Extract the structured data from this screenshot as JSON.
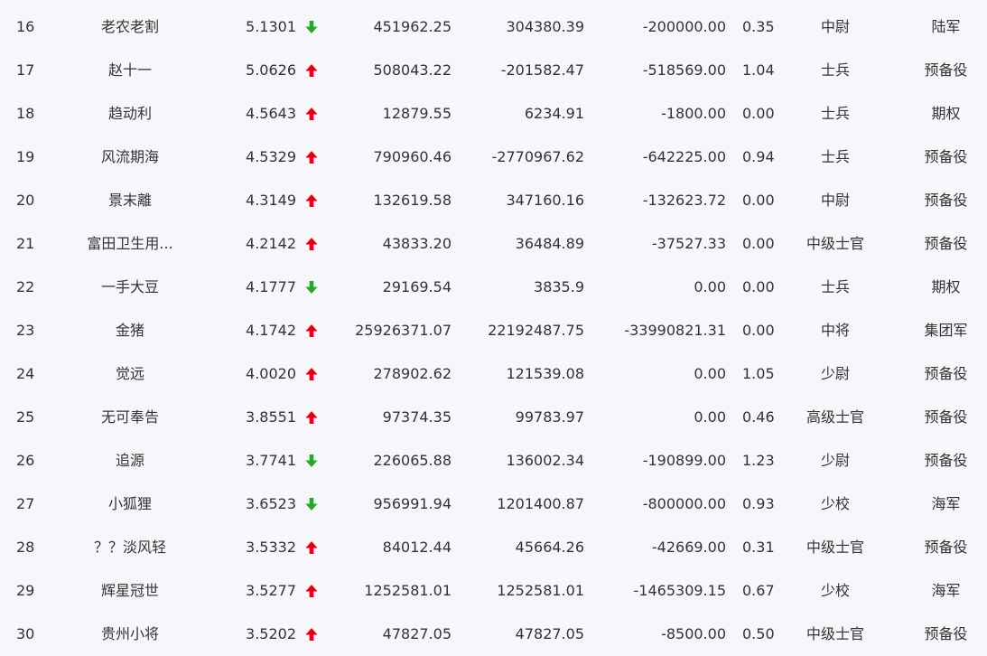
{
  "colors": {
    "up": "#e60012",
    "down": "#21ad2b",
    "text": "#333333",
    "background": "#f5f7fa"
  },
  "rows": [
    {
      "rank": "16",
      "name": "老农老割",
      "score": "5.1301",
      "trend": "down",
      "v1": "451962.25",
      "v2": "304380.39",
      "v3": "-200000.00",
      "ratio": "0.35",
      "military_rank": "中尉",
      "group": "陆军"
    },
    {
      "rank": "17",
      "name": "赵十一",
      "score": "5.0626",
      "trend": "up",
      "v1": "508043.22",
      "v2": "-201582.47",
      "v3": "-518569.00",
      "ratio": "1.04",
      "military_rank": "士兵",
      "group": "预备役"
    },
    {
      "rank": "18",
      "name": "趋动利",
      "score": "4.5643",
      "trend": "up",
      "v1": "12879.55",
      "v2": "6234.91",
      "v3": "-1800.00",
      "ratio": "0.00",
      "military_rank": "士兵",
      "group": "期权"
    },
    {
      "rank": "19",
      "name": "风流期海",
      "score": "4.5329",
      "trend": "up",
      "v1": "790960.46",
      "v2": "-2770967.62",
      "v3": "-642225.00",
      "ratio": "0.94",
      "military_rank": "士兵",
      "group": "预备役"
    },
    {
      "rank": "20",
      "name": "景末離",
      "score": "4.3149",
      "trend": "up",
      "v1": "132619.58",
      "v2": "347160.16",
      "v3": "-132623.72",
      "ratio": "0.00",
      "military_rank": "中尉",
      "group": "预备役"
    },
    {
      "rank": "21",
      "name": "富田卫生用...",
      "score": "4.2142",
      "trend": "up",
      "v1": "43833.20",
      "v2": "36484.89",
      "v3": "-37527.33",
      "ratio": "0.00",
      "military_rank": "中级士官",
      "group": "预备役"
    },
    {
      "rank": "22",
      "name": "一手大豆",
      "score": "4.1777",
      "trend": "down",
      "v1": "29169.54",
      "v2": "3835.9",
      "v3": "0.00",
      "ratio": "0.00",
      "military_rank": "士兵",
      "group": "期权"
    },
    {
      "rank": "23",
      "name": "金猪",
      "score": "4.1742",
      "trend": "up",
      "v1": "25926371.07",
      "v2": "22192487.75",
      "v3": "-33990821.31",
      "ratio": "0.00",
      "military_rank": "中将",
      "group": "集团军"
    },
    {
      "rank": "24",
      "name": "觉远",
      "score": "4.0020",
      "trend": "up",
      "v1": "278902.62",
      "v2": "121539.08",
      "v3": "0.00",
      "ratio": "1.05",
      "military_rank": "少尉",
      "group": "预备役"
    },
    {
      "rank": "25",
      "name": "无可奉告",
      "score": "3.8551",
      "trend": "up",
      "v1": "97374.35",
      "v2": "99783.97",
      "v3": "0.00",
      "ratio": "0.46",
      "military_rank": "高级士官",
      "group": "预备役"
    },
    {
      "rank": "26",
      "name": "追源",
      "score": "3.7741",
      "trend": "down",
      "v1": "226065.88",
      "v2": "136002.34",
      "v3": "-190899.00",
      "ratio": "1.23",
      "military_rank": "少尉",
      "group": "预备役"
    },
    {
      "rank": "27",
      "name": "小狐狸",
      "score": "3.6523",
      "trend": "down",
      "v1": "956991.94",
      "v2": "1201400.87",
      "v3": "-800000.00",
      "ratio": "0.93",
      "military_rank": "少校",
      "group": "海军"
    },
    {
      "rank": "28",
      "name": "？？淡风轻",
      "score": "3.5332",
      "trend": "up",
      "v1": "84012.44",
      "v2": "45664.26",
      "v3": "-42669.00",
      "ratio": "0.31",
      "military_rank": "中级士官",
      "group": "预备役"
    },
    {
      "rank": "29",
      "name": "辉星冠世",
      "score": "3.5277",
      "trend": "up",
      "v1": "1252581.01",
      "v2": "1252581.01",
      "v3": "-1465309.15",
      "ratio": "0.67",
      "military_rank": "少校",
      "group": "海军"
    },
    {
      "rank": "30",
      "name": "贵州小将",
      "score": "3.5202",
      "trend": "up",
      "v1": "47827.05",
      "v2": "47827.05",
      "v3": "-8500.00",
      "ratio": "0.50",
      "military_rank": "中级士官",
      "group": "预备役"
    }
  ]
}
